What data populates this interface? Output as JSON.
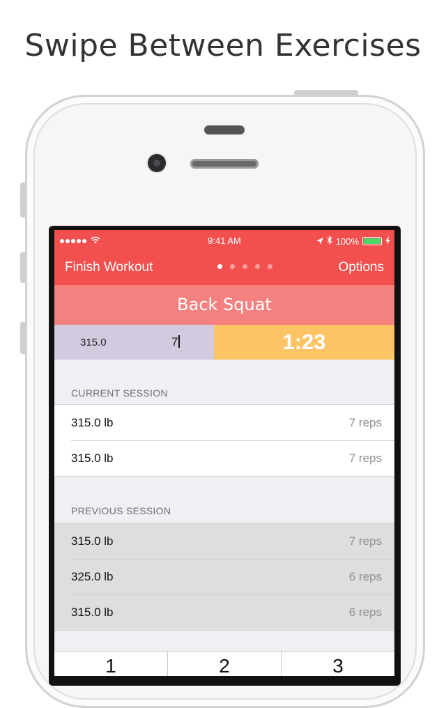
{
  "headline": "Swipe Between Exercises",
  "status_bar": {
    "time": "9:41 AM",
    "battery": "100%",
    "battery_level": 1.0
  },
  "nav": {
    "left_label": "Finish Workout",
    "right_label": "Options",
    "page_count": 5,
    "active_page": 1
  },
  "exercise": {
    "title": "Back Squat",
    "weight_input": "315.0",
    "reps_input": "7",
    "timer": "1:23"
  },
  "current_session": {
    "header": "CURRENT SESSION",
    "rows": [
      {
        "weight": "315.0 lb",
        "reps": "7 reps"
      },
      {
        "weight": "315.0 lb",
        "reps": "7 reps"
      }
    ]
  },
  "previous_session": {
    "header": "PREVIOUS SESSION",
    "rows": [
      {
        "weight": "315.0 lb",
        "reps": "7 reps"
      },
      {
        "weight": "325.0 lb",
        "reps": "6 reps"
      },
      {
        "weight": "315.0 lb",
        "reps": "6 reps"
      }
    ]
  },
  "keypad": {
    "keys": [
      "1",
      "2",
      "3"
    ]
  },
  "colors": {
    "nav_red": "#f2504e",
    "title_pink": "#f48080",
    "input_lavender": "#d3cae0",
    "timer_amber": "#fdc465"
  },
  "icons": {
    "signal": "signal-dots-icon",
    "wifi": "wifi-icon",
    "location": "location-arrow-icon",
    "bluetooth": "bluetooth-icon",
    "battery": "battery-icon",
    "charging": "charging-bolt-icon"
  }
}
